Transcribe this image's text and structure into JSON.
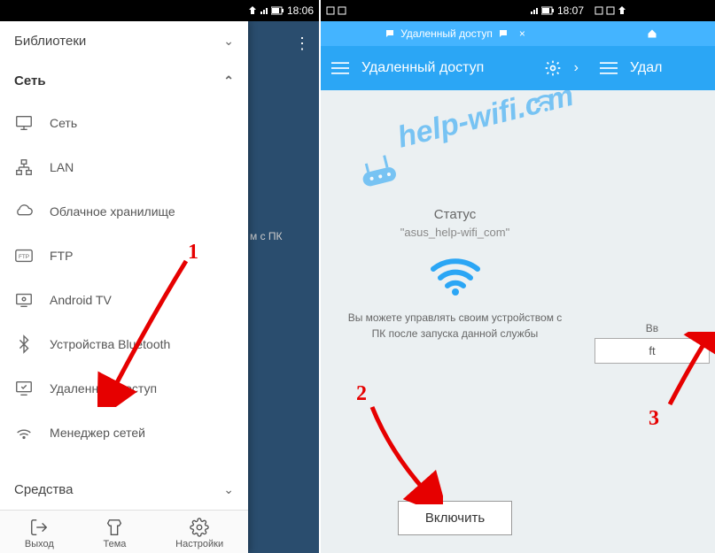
{
  "statusbar": {
    "time": "18:06",
    "time2": "18:07"
  },
  "drawer": {
    "section_libraries": "Библиотеки",
    "section_network": "Сеть",
    "section_tools": "Средства",
    "items": [
      {
        "label": "Сеть"
      },
      {
        "label": "LAN"
      },
      {
        "label": "Облачное хранилище"
      },
      {
        "label": "FTP"
      },
      {
        "label": "Android TV"
      },
      {
        "label": "Устройства Bluetooth"
      },
      {
        "label": "Удаленный доступ"
      },
      {
        "label": "Менеджер сетей"
      }
    ],
    "bottom": {
      "exit": "Выход",
      "theme": "Тема",
      "settings": "Настройки"
    }
  },
  "screen2": {
    "topbar": "Удаленный доступ",
    "appbar_title": "Удаленный доступ",
    "status_label": "Статус",
    "status_value": "\"asus_help-wifi_com\"",
    "description": "Вы можете управлять своим устройством с ПК после запуска данной службы",
    "button": "Включить"
  },
  "screen3": {
    "appbar_title": "Удал",
    "input_label": "Вв",
    "input_value": "ft"
  },
  "hidden_text": "м с ПК",
  "annotations": {
    "n1": "1",
    "n2": "2",
    "n3": "3"
  },
  "watermark": "help-wifi.com"
}
